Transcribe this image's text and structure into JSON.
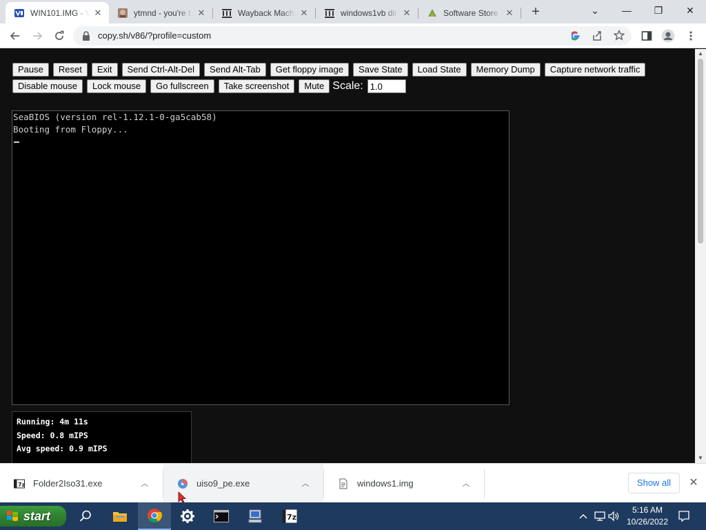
{
  "browser": {
    "tabs": [
      {
        "title": "WIN101.IMG - V",
        "favicon": "v86-icon",
        "active": true
      },
      {
        "title": "ytmnd - you're t",
        "favicon": "ytmnd-face-icon",
        "active": false
      },
      {
        "title": "Wayback Machi",
        "favicon": "archive-icon",
        "active": false
      },
      {
        "title": "windows1vb dir",
        "favicon": "archive-icon",
        "active": false
      },
      {
        "title": "Software Store -",
        "favicon": "software-store-icon",
        "active": false
      }
    ],
    "new_tab": "+",
    "window_controls": {
      "dropdown": "⌄",
      "minimize": "—",
      "maximize": "❐",
      "close": "✕"
    },
    "url": "copy.sh/v86/?profile=custom"
  },
  "emulator": {
    "buttons_row1": [
      "Pause",
      "Reset",
      "Exit",
      "Send Ctrl-Alt-Del",
      "Send Alt-Tab",
      "Get floppy image",
      "Save State",
      "Load State",
      "Memory Dump",
      "Capture network traffic"
    ],
    "buttons_row2": [
      "Disable mouse",
      "Lock mouse",
      "Go fullscreen",
      "Take screenshot",
      "Mute"
    ],
    "scale_label": "Scale:",
    "scale_value": "1.0",
    "screen_lines": [
      "SeaBIOS (version rel-1.12.1-0-ga5cab58)",
      "Booting from Floppy..."
    ],
    "stats": [
      "Running: 4m 11s",
      "Speed: 0.8 mIPS",
      "Avg speed: 0.9 mIPS"
    ]
  },
  "downloads": {
    "items": [
      {
        "name": "Folder2Iso31.exe",
        "icon": "7zip-icon"
      },
      {
        "name": "uiso9_pe.exe",
        "icon": "ultraiso-icon"
      },
      {
        "name": "windows1.img",
        "icon": "file-icon"
      }
    ],
    "show_all": "Show all",
    "close": "✕"
  },
  "taskbar": {
    "start_label": "start",
    "icons": [
      "search-icon",
      "file-explorer-icon",
      "chrome-icon",
      "settings-icon",
      "terminal-icon",
      "computer-icon",
      "7zip-icon"
    ],
    "clock_time": "5:16 AM",
    "clock_date": "10/26/2022"
  },
  "colors": {
    "page_bg": "#101010",
    "tabstrip_bg": "#dee1e6",
    "taskbar_bg": "#1e3a5f",
    "start_green": "#2f7f2f",
    "link_blue": "#1a73e8"
  }
}
